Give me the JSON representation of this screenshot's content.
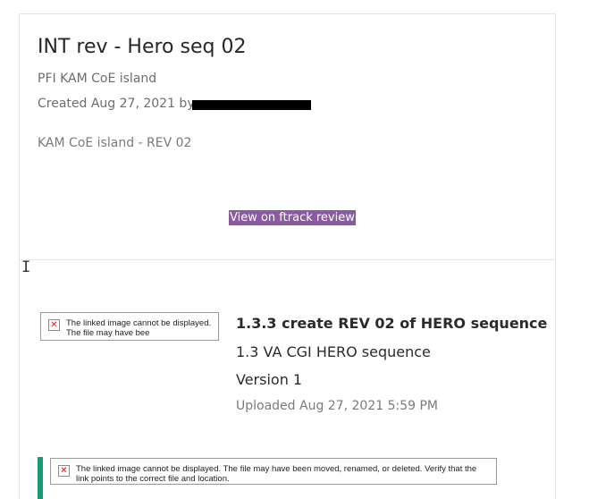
{
  "header": {
    "title": "INT rev - Hero seq 02",
    "project": "PFI KAM CoE island",
    "created": "Created Aug 27, 2021 by",
    "subtitle": "KAM CoE island - REV 02",
    "review_link": "View on ftrack review"
  },
  "version": {
    "title": "1.3.3 create REV 02 of HERO sequence",
    "task": "1.3 VA CGI HERO sequence",
    "number": "Version 1",
    "uploaded": "Uploaded Aug 27, 2021 5:59 PM"
  },
  "images": {
    "thumbnail_alt": "The linked image cannot be displayed.  The file may have bee",
    "footer_alt": "The linked image cannot be displayed.  The file may have been moved, renamed, or deleted. Verify that the link points to the correct file and location."
  },
  "icons": {
    "broken_image": "broken-image-icon",
    "cursor": "text-cursor-icon"
  },
  "colors": {
    "link_bg": "#8c5aa3",
    "accent": "#1a9a7a",
    "redaction": "#000000"
  }
}
